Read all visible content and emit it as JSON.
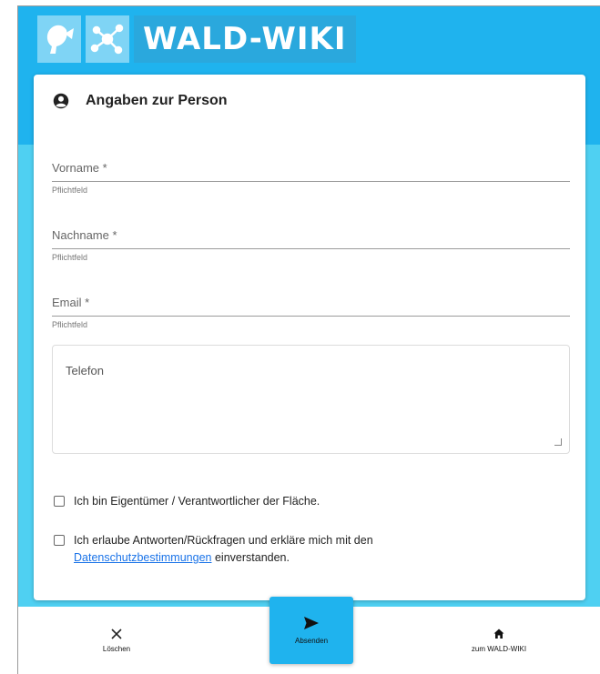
{
  "brand": {
    "name": "WALD-WIKI"
  },
  "form": {
    "section_title": "Angaben zur Person",
    "fields": [
      {
        "label": "Vorname *",
        "hint": "Pflichtfeld"
      },
      {
        "label": "Nachname *",
        "hint": "Pflichtfeld"
      },
      {
        "label": "Email *",
        "hint": "Pflichtfeld"
      }
    ],
    "telefon_label": "Telefon",
    "checkboxes": {
      "owner": "Ich bin Eigentümer / Verantwortlicher der Fläche.",
      "consent_before": "Ich erlaube Antworten/Rückfragen und erkläre mich mit den",
      "consent_link": "Datenschutzbestimmungen",
      "consent_after": "einverstanden."
    }
  },
  "nav": {
    "delete": "Löschen",
    "send": "Absenden",
    "home": "zum WALD-WIKI"
  },
  "colors": {
    "header": "#1fb3ee",
    "background": "#4fd0f2",
    "accent": "#1fb3ee",
    "link": "#1a73e8"
  }
}
